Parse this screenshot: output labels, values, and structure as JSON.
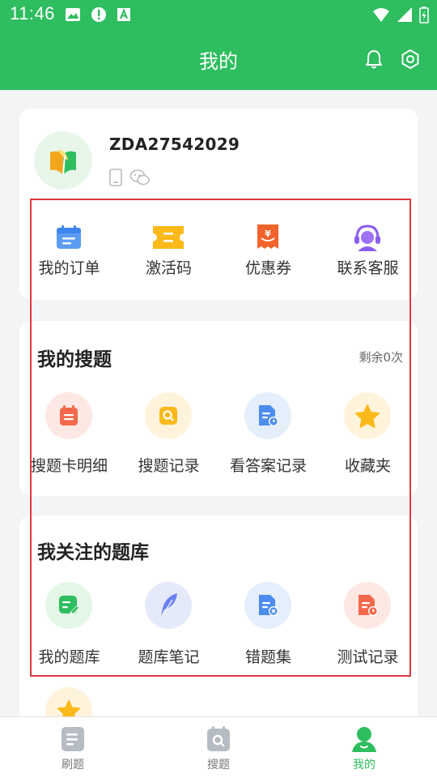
{
  "status_bar": {
    "time": "11:46"
  },
  "header": {
    "title": "我的"
  },
  "profile": {
    "username": "ZDA27542029",
    "actions": [
      {
        "label": "我的订单",
        "icon": "order-icon"
      },
      {
        "label": "激活码",
        "icon": "activation-code-icon"
      },
      {
        "label": "优惠券",
        "icon": "coupon-icon"
      },
      {
        "label": "联系客服",
        "icon": "customer-service-icon"
      }
    ]
  },
  "search_section": {
    "title": "我的搜题",
    "remaining": "剩余0次",
    "items": [
      {
        "label": "搜题卡明细",
        "icon": "search-card-detail-icon"
      },
      {
        "label": "搜题记录",
        "icon": "search-record-icon"
      },
      {
        "label": "看答案记录",
        "icon": "answer-record-icon"
      },
      {
        "label": "收藏夹",
        "icon": "favorites-star-icon"
      }
    ]
  },
  "library_section": {
    "title": "我关注的题库",
    "items": [
      {
        "label": "我的题库",
        "icon": "my-library-icon"
      },
      {
        "label": "题库笔记",
        "icon": "notes-feather-icon"
      },
      {
        "label": "错题集",
        "icon": "wrong-questions-icon"
      },
      {
        "label": "测试记录",
        "icon": "test-record-icon"
      }
    ]
  },
  "bottom_nav": [
    {
      "label": "刷题",
      "icon": "practice-icon",
      "active": false
    },
    {
      "label": "搜题",
      "icon": "search-questions-icon",
      "active": false
    },
    {
      "label": "我的",
      "icon": "profile-icon",
      "active": true
    }
  ],
  "colors": {
    "primary": "#2ebd5f",
    "highlight": "#e0393e"
  }
}
